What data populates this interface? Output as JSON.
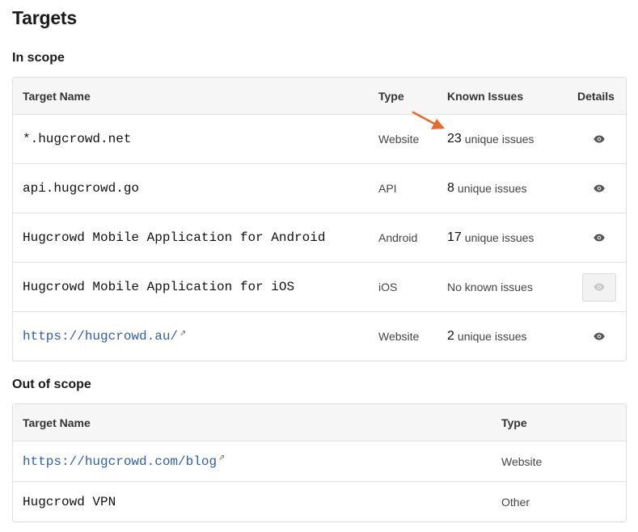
{
  "page": {
    "title": "Targets"
  },
  "in_scope": {
    "heading": "In scope",
    "columns": {
      "name": "Target Name",
      "type": "Type",
      "known": "Known Issues",
      "details": "Details"
    },
    "rows": [
      {
        "name": "*.hugcrowd.net",
        "type": "Website",
        "count": "23",
        "suffix": "unique issues"
      },
      {
        "name": "api.hugcrowd.go",
        "type": "API",
        "count": "8",
        "suffix": "unique issues"
      },
      {
        "name": "Hugcrowd Mobile Application for Android",
        "type": "Android",
        "count": "17",
        "suffix": "unique issues"
      },
      {
        "name": "Hugcrowd Mobile Application for iOS",
        "type": "iOS",
        "none": "No known issues"
      },
      {
        "name": "https://hugcrowd.au/",
        "type": "Website",
        "count": "2",
        "suffix": "unique issues",
        "external": "⇗"
      }
    ]
  },
  "out_scope": {
    "heading": "Out of scope",
    "columns": {
      "name": "Target Name",
      "type": "Type"
    },
    "rows": [
      {
        "name": "https://hugcrowd.com/blog",
        "type": "Website",
        "external": "⇗"
      },
      {
        "name": "Hugcrowd VPN",
        "type": "Other"
      }
    ]
  },
  "colors": {
    "link": "#2f5fa7",
    "annotation_arrow": "#e8692e",
    "header_bg": "#f6f6f6"
  },
  "icons": {
    "details": "eye-icon",
    "external": "external-link-icon",
    "annotation": "arrow-annotation"
  }
}
